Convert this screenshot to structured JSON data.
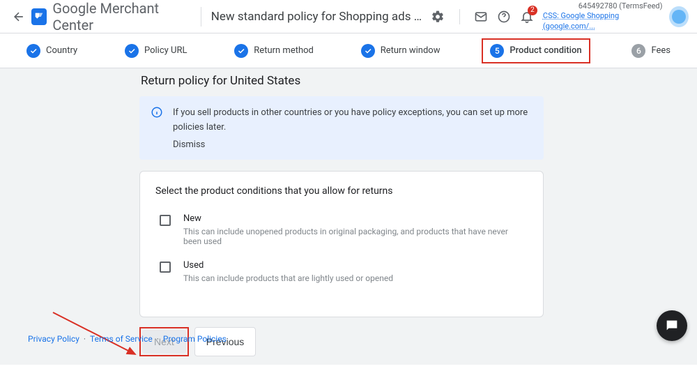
{
  "header": {
    "brand_gray": "Google",
    "brand_rest": " Merchant Center",
    "page_title": "New standard policy for Shopping ads and ...",
    "notif_count": "2",
    "account_id": "645492780 (TermsFeed)",
    "css_link": "CSS: Google Shopping (google.com/..."
  },
  "stepper": [
    {
      "label": "Country",
      "state": "done"
    },
    {
      "label": "Policy URL",
      "state": "done"
    },
    {
      "label": "Return method",
      "state": "done"
    },
    {
      "label": "Return window",
      "state": "done"
    },
    {
      "label": "Product condition",
      "state": "current",
      "num": "5"
    },
    {
      "label": "Fees",
      "state": "upcoming",
      "num": "6"
    }
  ],
  "section_title": "Return policy for United States",
  "info": {
    "text": "If you sell products in other countries or you have policy exceptions, you can set up more policies later.",
    "dismiss": "Dismiss"
  },
  "card": {
    "title": "Select the product conditions that you allow for returns",
    "options": [
      {
        "label": "New",
        "desc": "This can include unopened products in original packaging, and products that have never been used"
      },
      {
        "label": "Used",
        "desc": "This can include products that are lightly used or opened"
      }
    ]
  },
  "buttons": {
    "next": "Next",
    "previous": "Previous"
  },
  "footer": {
    "privacy": "Privacy Policy",
    "terms": "Terms of Service",
    "program": "Program Policies"
  }
}
